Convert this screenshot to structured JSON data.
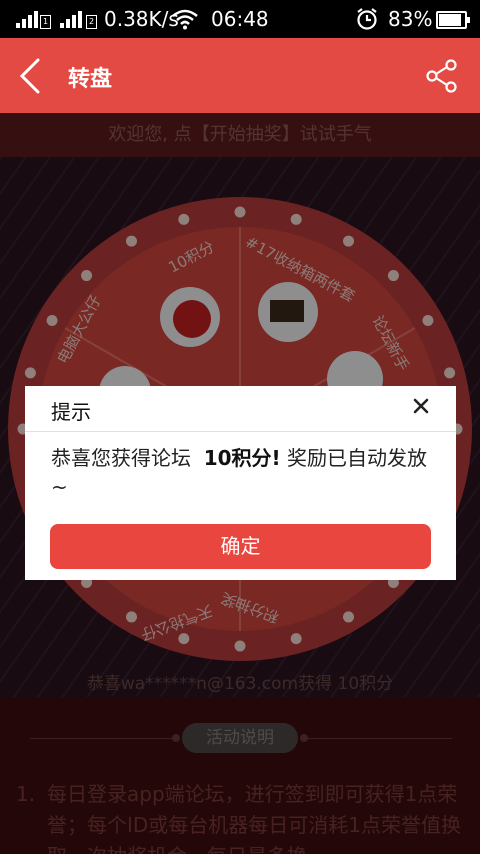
{
  "status_bar": {
    "speed": "0.38K/s",
    "time": "06:48",
    "battery": "83%",
    "battery_level": 0.83,
    "sim1": "1",
    "sim2": "2"
  },
  "app_bar": {
    "back_icon": "chevron-left-icon",
    "title": "转盘",
    "share_icon": "share-icon"
  },
  "welcome": "欢迎您, 点【开始抽奖】试试手气",
  "wheel": {
    "segments": [
      "10积分",
      "#17收纳箱两件套",
      "论坛新手",
      "积分抽奖",
      "天气抢公仔",
      "电脑大公仔"
    ]
  },
  "ticker": "恭喜wa******n@163.com获得 10积分",
  "rules": {
    "button": "活动说明",
    "item_number": "1.",
    "item_text": "每日登录app端论坛，进行签到即可获得1点荣誉；每个ID或每台机器每日可消耗1点荣誉值换取一次抽奖机会，每日最多换"
  },
  "dialog": {
    "title": "提示",
    "message_prefix": "恭喜您获得论坛",
    "message_prize": "10积分!",
    "message_suffix": "奖励已自动发放~",
    "confirm": "确定",
    "close_icon": "close-icon"
  },
  "colors": {
    "app_bar": "#e34a44",
    "confirm_button": "#e8463f",
    "wheel": "#c6393a"
  }
}
